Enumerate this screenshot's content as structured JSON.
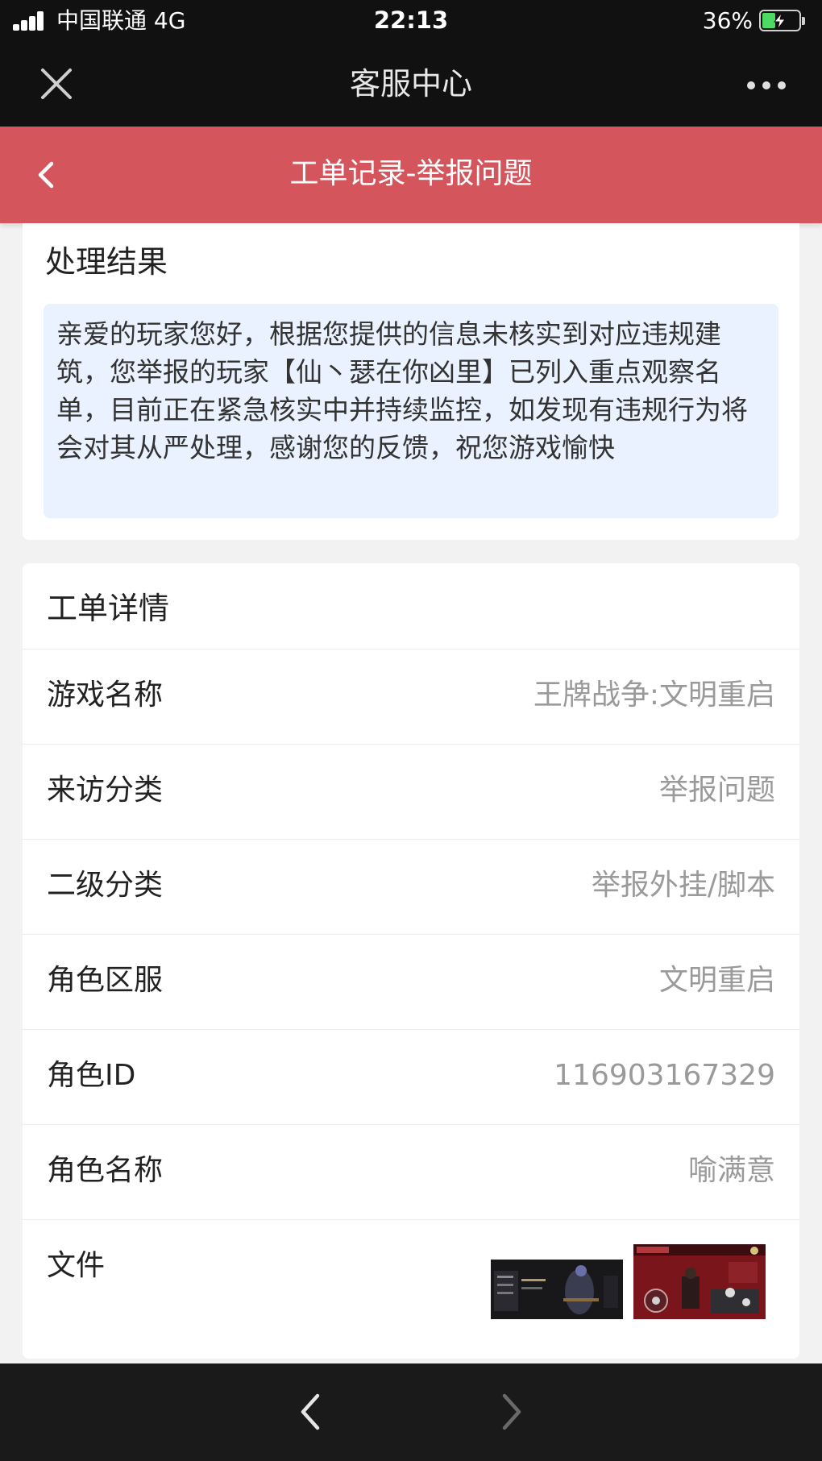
{
  "status_bar": {
    "carrier": "中国联通  4G",
    "time": "22:13",
    "battery": "36%",
    "battery_level": 0.36
  },
  "nav_bar": {
    "title": "客服中心",
    "close_icon": "close-icon",
    "more_icon": "more-dots-icon"
  },
  "header": {
    "title": "工单记录-举报问题",
    "back_icon": "chevron-left-icon",
    "color": "#d5555d"
  },
  "result": {
    "heading": "处理结果",
    "text": "亲爱的玩家您好，根据您提供的信息未核实到对应违规建筑，您举报的玩家【仙丶瑟在你凶里】已列入重点观察名单，目前正在紧急核实中并持续监控，如发现有违规行为将会对其从严处理，感谢您的反馈，祝您游戏愉快"
  },
  "detail": {
    "heading": "工单详情",
    "rows": [
      {
        "label": "游戏名称",
        "value": "王牌战争:文明重启"
      },
      {
        "label": "来访分类",
        "value": "举报问题"
      },
      {
        "label": "二级分类",
        "value": "举报外挂/脚本"
      },
      {
        "label": "角色区服",
        "value": "文明重启"
      },
      {
        "label": "角色ID",
        "value": "116903167329"
      },
      {
        "label": "角色名称",
        "value": "喻满意"
      }
    ],
    "files_label": "文件"
  },
  "bottom_nav": {
    "back_icon": "chevron-left-icon",
    "forward_icon": "chevron-right-icon"
  }
}
